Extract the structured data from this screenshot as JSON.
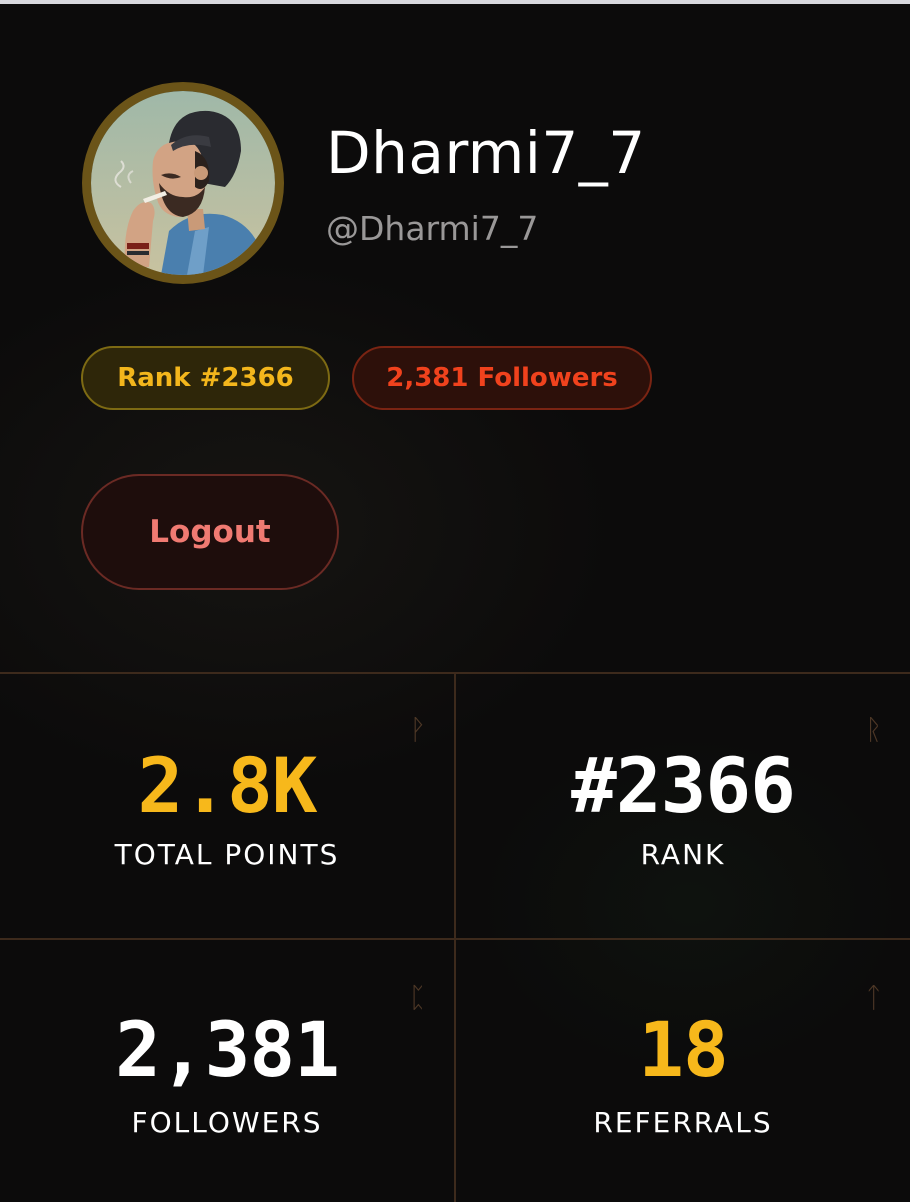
{
  "profile": {
    "display_name": "Dharmi7_7",
    "handle": "@Dharmi7_7"
  },
  "badges": {
    "rank": "Rank #2366",
    "followers": "2,381 Followers"
  },
  "actions": {
    "logout": "Logout"
  },
  "stats": [
    {
      "value": "2.8K",
      "label": "TOTAL POINTS",
      "rune": "ᚹ"
    },
    {
      "value": "#2366",
      "label": "RANK",
      "rune": "ᚱ"
    },
    {
      "value": "2,381",
      "label": "FOLLOWERS",
      "rune": "ᛈ"
    },
    {
      "value": "18",
      "label": "REFERRALS",
      "rune": "ᛏ"
    }
  ],
  "colors": {
    "background": "#0c0b0b",
    "gold": "#f7b81b",
    "followers_accent": "#f0421d",
    "logout_text": "#f07a72",
    "grid_lines": "#3d2a1c"
  },
  "icons": {
    "avatar": "illustrated-bearded-man-avatar"
  }
}
